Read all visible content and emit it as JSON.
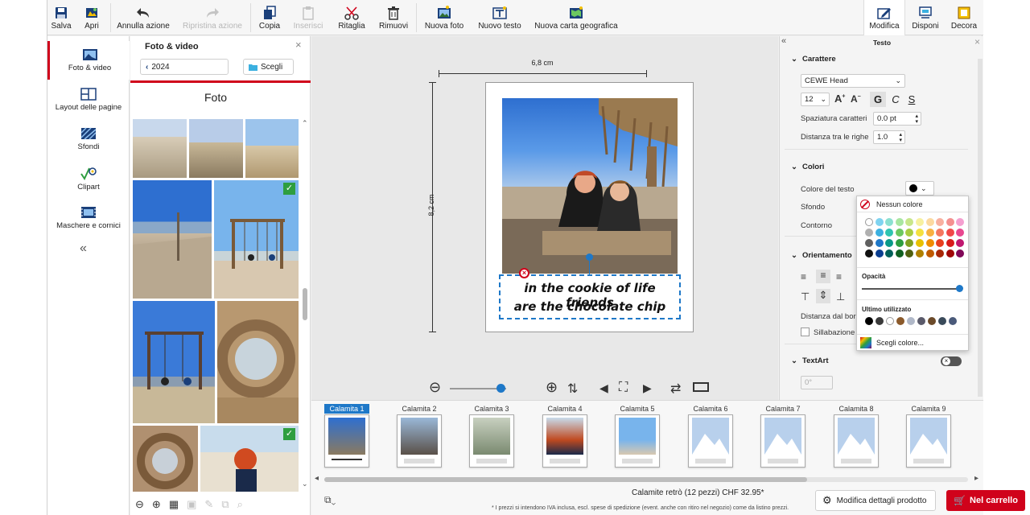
{
  "toolbar": {
    "save": "Salva",
    "open": "Apri",
    "undo": "Annulla azione",
    "redo": "Ripristina azione",
    "copy": "Copia",
    "paste": "Inserisci",
    "cut": "Ritaglia",
    "remove": "Rimuovi",
    "new_photo": "Nuova foto",
    "new_text": "Nuovo testo",
    "new_map": "Nuova carta geografica",
    "edit": "Modifica",
    "arrange": "Disponi",
    "decorate": "Decora"
  },
  "leftnav": {
    "items": [
      "Foto & video",
      "Layout delle pagine",
      "Sfondi",
      "Clipart",
      "Maschere e cornici"
    ]
  },
  "photopanel": {
    "title": "Foto & video",
    "folder": "2024",
    "choose": "Scegli",
    "section": "Foto"
  },
  "canvas": {
    "width_label": "6,8 cm",
    "height_label": "8,2 cm",
    "caption_line1": "in the cookie of life friends",
    "caption_line2": "are the chocolate chip"
  },
  "rightpanel": {
    "header": "Testo",
    "character": "Carattere",
    "font": "CEWE Head",
    "font_size": "12",
    "bold": "G",
    "italic": "C",
    "underline": "S",
    "spacing_label": "Spaziatura caratteri",
    "spacing_value": "0.0 pt",
    "line_label": "Distanza tra le righe",
    "line_value": "1.0",
    "colors": "Colori",
    "text_color": "Colore del testo",
    "background": "Sfondo",
    "outline": "Contorno",
    "orientation": "Orientamento",
    "border_distance": "Distanza dal bordo",
    "hyphenation": "Sillabazione",
    "textart": "TextArt",
    "angle": "0°"
  },
  "colorpopup": {
    "no_color": "Nessun colore",
    "opacity": "Opacità",
    "recent": "Ultimo utilizzato",
    "choose": "Scegli colore...",
    "opacity_value": 1.0,
    "palette": [
      [
        "#ffffff",
        "#7fd3f0",
        "#8be0d0",
        "#a8e6a0",
        "#c8e68a",
        "#f7f0a0",
        "#fcd9a0",
        "#f8b0a0",
        "#f49090",
        "#f4a0d0"
      ],
      [
        "#b0b0b0",
        "#3bb0e0",
        "#2ec4b0",
        "#6cc860",
        "#a8cc40",
        "#f4e040",
        "#f8b040",
        "#f47860",
        "#f04848",
        "#e84890"
      ],
      [
        "#606060",
        "#1e78c8",
        "#0a9a88",
        "#2e9e40",
        "#80a020",
        "#e8c000",
        "#f08c00",
        "#e84020",
        "#d81c1c",
        "#c01870"
      ],
      [
        "#101010",
        "#0a3e90",
        "#006058",
        "#106020",
        "#506010",
        "#b08000",
        "#c05a00",
        "#a82808",
        "#a00808",
        "#800858"
      ]
    ],
    "recent_colors": [
      "#000000",
      "#3a3a3a",
      "#ffffff",
      "#8b5a2b",
      "#b0b8c8",
      "#5a5a6a",
      "#6b4a2a",
      "#3a4a5a",
      "#4a5a7a"
    ]
  },
  "filmstrip": {
    "items": [
      "Calamita 1",
      "Calamita 2",
      "Calamita 3",
      "Calamita 4",
      "Calamita 5",
      "Calamita 6",
      "Calamita 7",
      "Calamita 8",
      "Calamita 9"
    ]
  },
  "bottom": {
    "price": "Calamite retrò (12 pezzi) CHF 32.95*",
    "note": "* I prezzi si intendono IVA inclusa, escl. spese di spedizione (event. anche con ritiro nel negozio) come da listino prezzi.",
    "details": "Modifica dettagli prodotto",
    "cart": "Nel carrello"
  }
}
